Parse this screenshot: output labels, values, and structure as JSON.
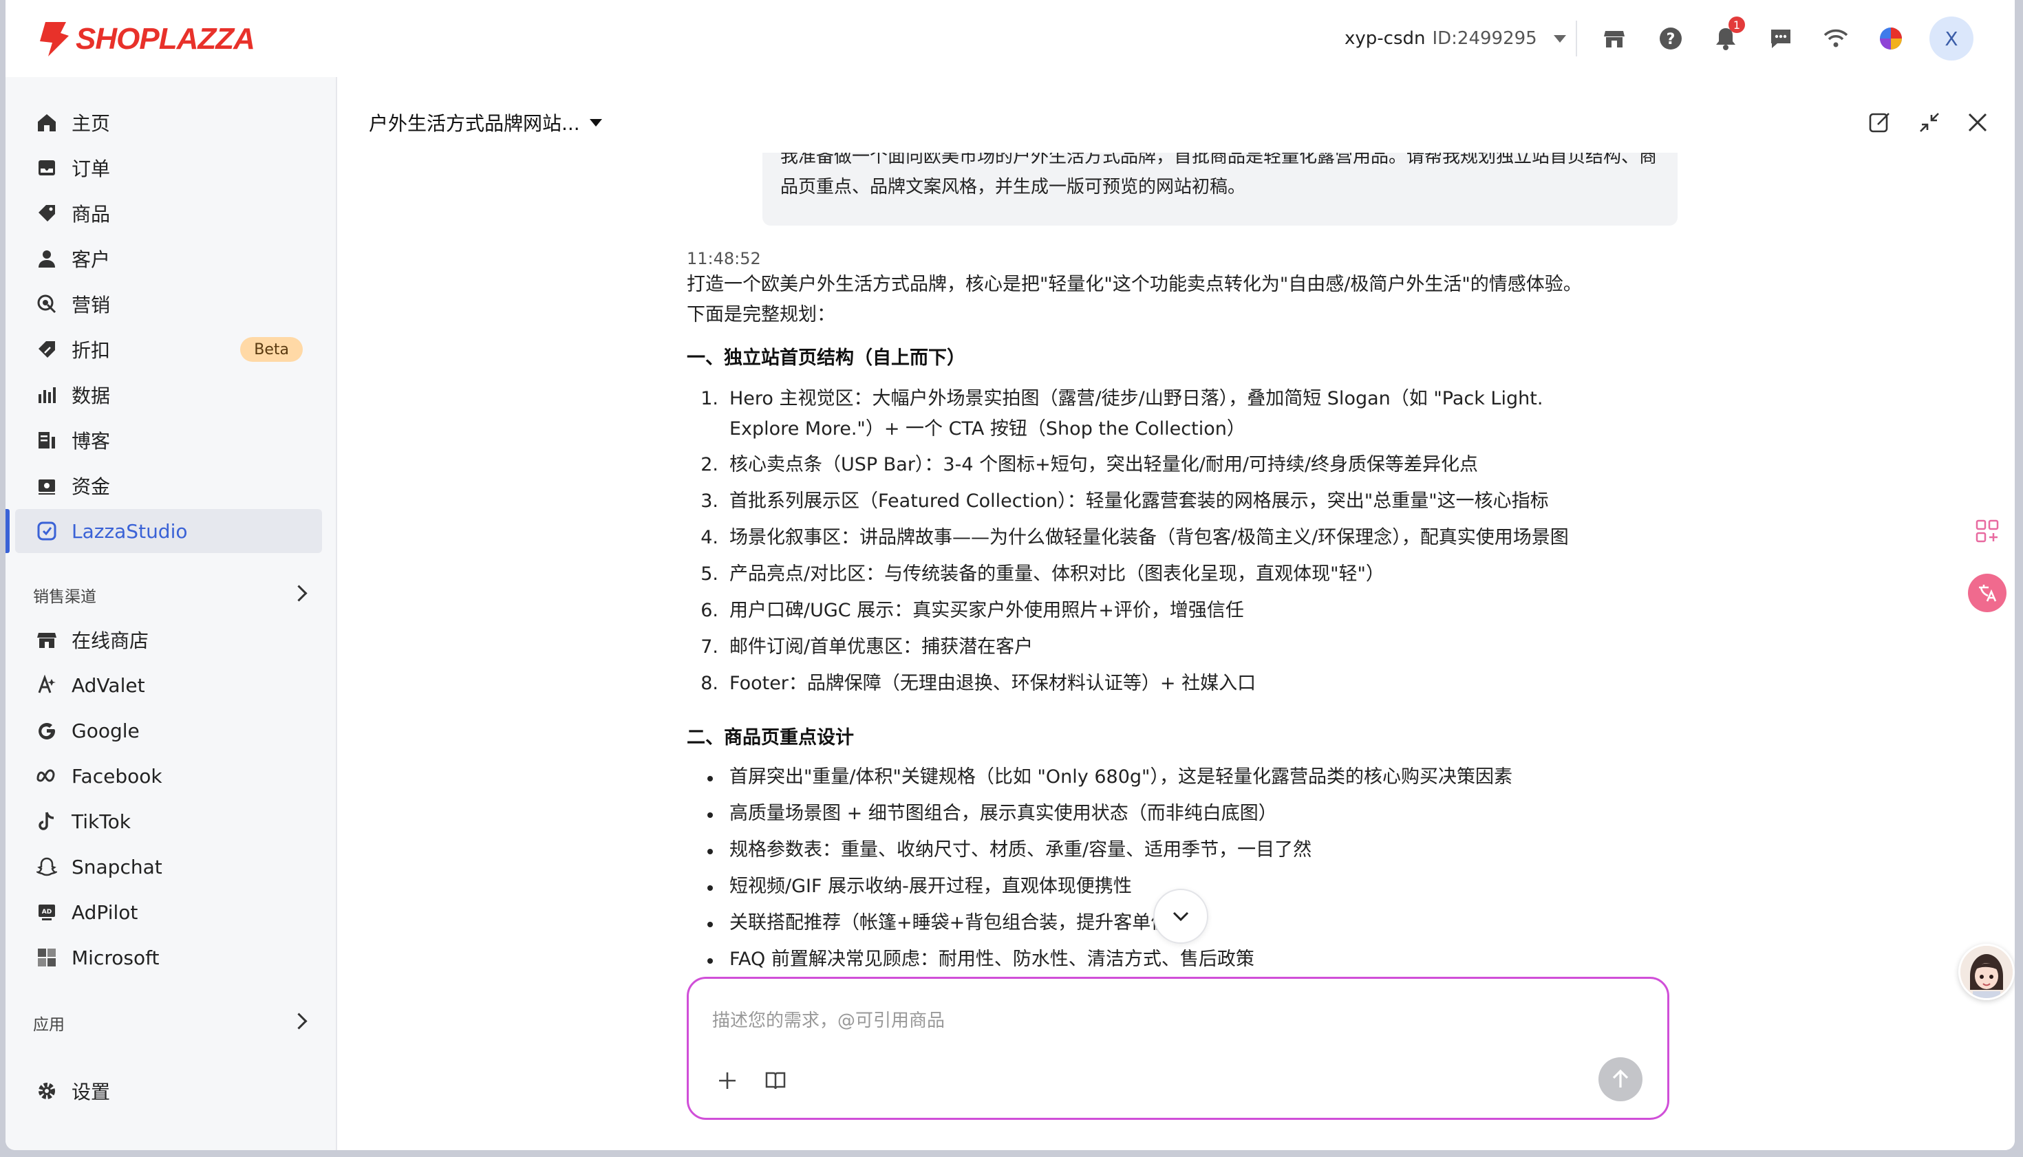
{
  "brand": {
    "name": "SHOPLAZZA",
    "color": "#e8312a"
  },
  "topbar": {
    "account_name": "xyp-csdn",
    "account_id": "ID:2499295",
    "notification_count": "1",
    "avatar_letter": "X",
    "icons": [
      "store-icon",
      "help-icon",
      "bell-icon",
      "chat-icon",
      "wifi-icon",
      "color-wheel-icon"
    ]
  },
  "sidebar": {
    "items": [
      {
        "label": "主页",
        "icon": "home-icon"
      },
      {
        "label": "订单",
        "icon": "inbox-icon"
      },
      {
        "label": "商品",
        "icon": "tag-icon"
      },
      {
        "label": "客户",
        "icon": "person-icon"
      },
      {
        "label": "营销",
        "icon": "marketing-icon"
      },
      {
        "label": "折扣",
        "icon": "discount-icon",
        "badge": "Beta"
      },
      {
        "label": "数据",
        "icon": "bar-chart-icon"
      },
      {
        "label": "博客",
        "icon": "blog-icon"
      },
      {
        "label": "资金",
        "icon": "wallet-icon"
      },
      {
        "label": "LazzaStudio",
        "icon": "studio-icon",
        "active": true
      }
    ],
    "channels_title": "销售渠道",
    "channels": [
      {
        "label": "在线商店",
        "icon": "store-icon"
      },
      {
        "label": "AdValet",
        "icon": "advalet-icon"
      },
      {
        "label": "Google",
        "icon": "google-icon"
      },
      {
        "label": "Facebook",
        "icon": "meta-icon"
      },
      {
        "label": "TikTok",
        "icon": "tiktok-icon"
      },
      {
        "label": "Snapchat",
        "icon": "snapchat-icon"
      },
      {
        "label": "AdPilot",
        "icon": "adpilot-icon"
      },
      {
        "label": "Microsoft",
        "icon": "microsoft-icon"
      }
    ],
    "apps_title": "应用",
    "settings_label": "设置"
  },
  "main": {
    "conversation_title": "户外生活方式品牌网站...",
    "user_message": "我准备做一个面向欧美市场的户外生活方式品牌，首批商品是轻量化露营用品。请帮我规划独立站首页结构、商品页重点、品牌文案风格，并生成一版可预览的网站初稿。",
    "reply": {
      "time": "11:48:52",
      "intro": "打造一个欧美户外生活方式品牌，核心是把\"轻量化\"这个功能卖点转化为\"自由感/极简户外生活\"的情感体验。下面是完整规划：",
      "section1_title": "一、独立站首页结构（自上而下）",
      "section1_items": [
        "Hero 主视觉区：大幅户外场景实拍图（露营/徒步/山野日落），叠加简短 Slogan（如 \"Pack Light. Explore More.\"）+ 一个 CTA 按钮（Shop the Collection）",
        "核心卖点条（USP Bar）：3-4 个图标+短句，突出轻量化/耐用/可持续/终身质保等差异化点",
        "首批系列展示区（Featured Collection）：轻量化露营套装的网格展示，突出\"总重量\"这一核心指标",
        "场景化叙事区：讲品牌故事——为什么做轻量化装备（背包客/极简主义/环保理念），配真实使用场景图",
        "产品亮点/对比区：与传统装备的重量、体积对比（图表化呈现，直观体现\"轻\"）",
        "用户口碑/UGC 展示：真实买家户外使用照片+评价，增强信任",
        "邮件订阅/首单优惠区：捕获潜在客户",
        "Footer：品牌保障（无理由退换、环保材料认证等）+ 社媒入口"
      ],
      "section2_title": "二、商品页重点设计",
      "section2_items": [
        "首屏突出\"重量/体积\"关键规格（比如 \"Only 680g\"），这是轻量化露营品类的核心购买决策因素",
        "高质量场景图 + 细节图组合，展示真实使用状态（而非纯白底图）",
        "规格参数表：重量、收纳尺寸、材质、承重/容量、适用季节，一目了然",
        "短视频/GIF 展示收纳-展开过程，直观体现便携性",
        "关联搭配推荐（帐篷+睡袋+背包组合装，提升客单价）",
        "FAQ 前置解决常见顾虑：耐用性、防水性、清洁方式、售后政策"
      ]
    },
    "composer": {
      "placeholder": "描述您的需求，@可引用商品"
    }
  },
  "colors": {
    "accent": "#3a62d6",
    "composer_border": "#d04fd8",
    "badge_bg": "#ffd9a6"
  }
}
